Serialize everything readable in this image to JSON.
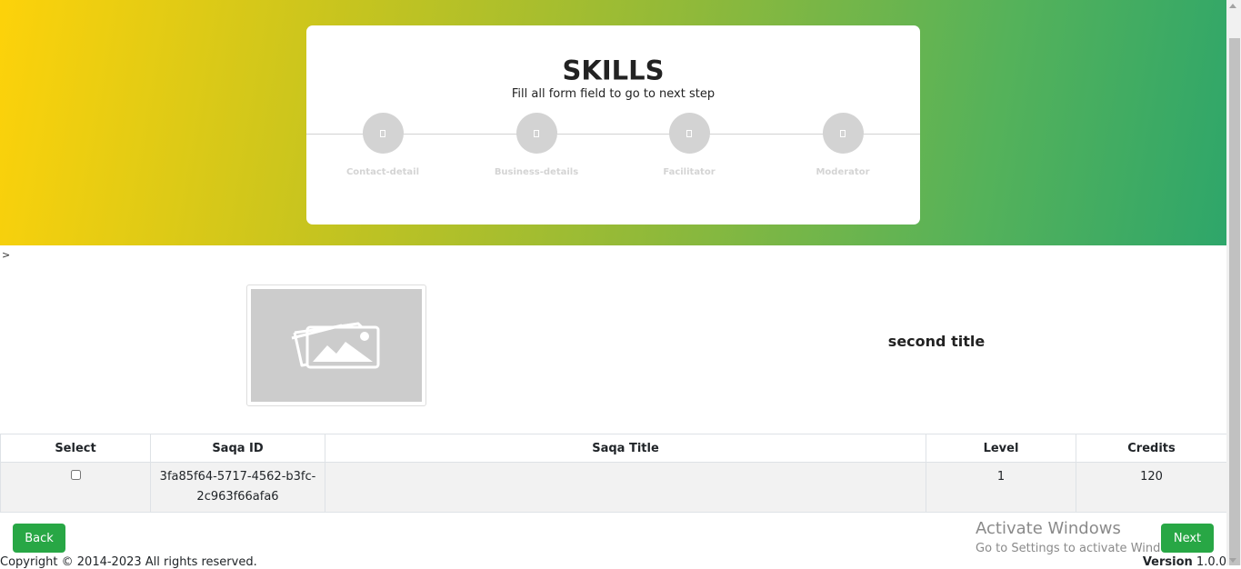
{
  "header": {
    "title": "SKILLS",
    "subtitle": "Fill all form field to go to next step"
  },
  "steps": [
    {
      "label": "Contact-detail",
      "icon": "step-icon"
    },
    {
      "label": "Business-details",
      "icon": "step-icon"
    },
    {
      "label": "Facilitator",
      "icon": "step-icon"
    },
    {
      "label": "Moderator",
      "icon": "step-icon"
    }
  ],
  "stray_text": ">",
  "media": {
    "image": "image-placeholder-icon",
    "second_title": "second title"
  },
  "table": {
    "headers": [
      "Select",
      "Saqa ID",
      "Saqa Title",
      "Level",
      "Credits"
    ],
    "rows": [
      {
        "selected": false,
        "saqa_id": "3fa85f64-5717-4562-b3fc-2c963f66afa6",
        "saqa_title": "",
        "level": "1",
        "credits": "120"
      }
    ]
  },
  "buttons": {
    "back": "Back",
    "next": "Next"
  },
  "watermark": {
    "title": "Activate Windows",
    "subtitle": "Go to Settings to activate Windows."
  },
  "footer": {
    "copyright": "Copyright © 2014-2023 All rights reserved.",
    "version_label": "Version",
    "version_value": "1.0.0"
  },
  "colors": {
    "gradient_start": "#fdd20a",
    "gradient_end": "#2ea66a",
    "button": "#28a745",
    "step_circle": "#d3d3d3"
  }
}
